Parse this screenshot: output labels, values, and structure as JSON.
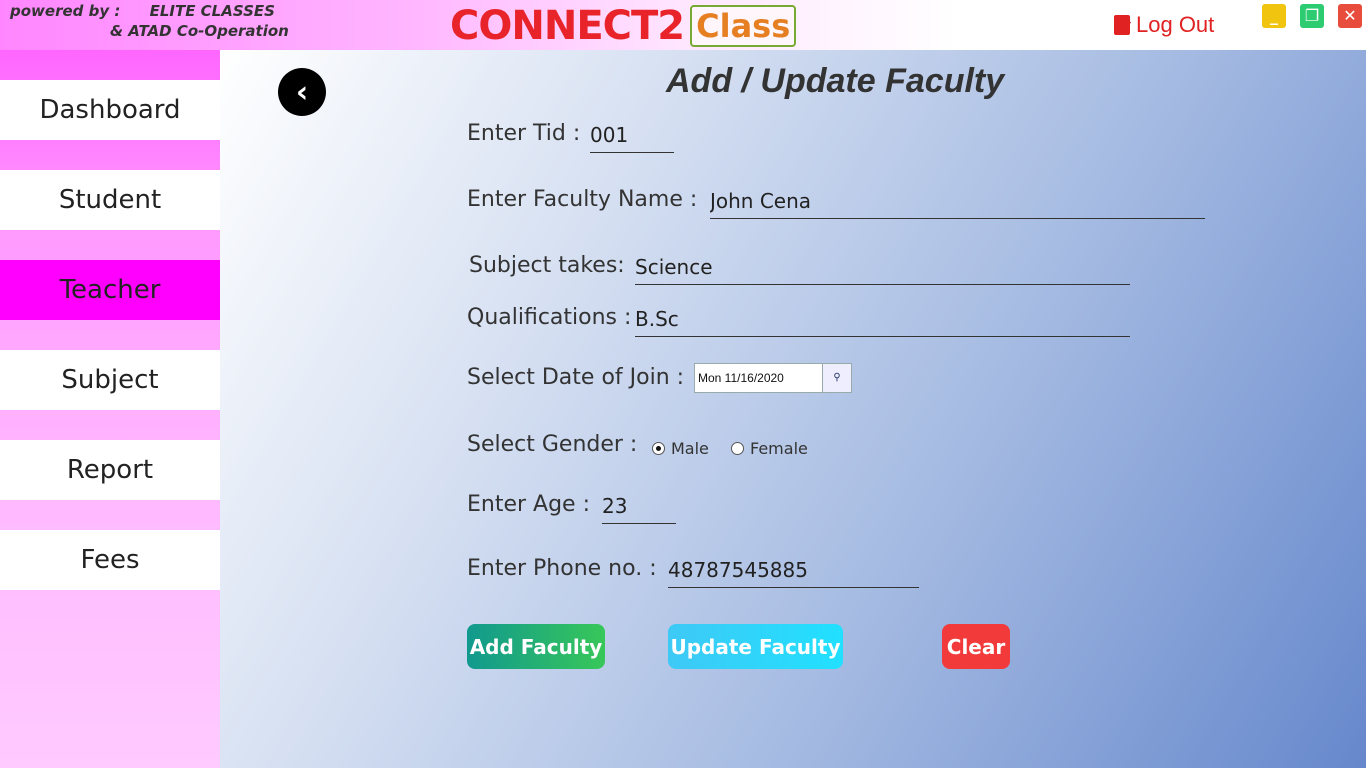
{
  "header": {
    "powered_line1": "powered by :",
    "powered_org": "ELITE CLASSES",
    "powered_line2": "& ATAD Co-Operation",
    "logo_main": "CONNECT2",
    "logo_class": "Class",
    "logout_label": "Log Out",
    "minimize": "_",
    "maximize": "❐",
    "close": "✕"
  },
  "sidebar": {
    "items": [
      {
        "label": "Dashboard",
        "active": false
      },
      {
        "label": "Student",
        "active": false
      },
      {
        "label": "Teacher",
        "active": true
      },
      {
        "label": "Subject",
        "active": false
      },
      {
        "label": "Report",
        "active": false
      },
      {
        "label": "Fees",
        "active": false
      }
    ]
  },
  "form": {
    "title": "Add / Update Faculty",
    "tid_label": "Enter Tid :",
    "tid_value": "001",
    "name_label": "Enter Faculty Name :",
    "name_value": "John Cena",
    "subject_label": "Subject takes:",
    "subject_value": "Science",
    "qual_label": "Qualifications :",
    "qual_value": "B.Sc",
    "doj_label": "Select Date of Join :",
    "doj_value": "Mon 11/16/2020",
    "gender_label": "Select Gender :",
    "gender_options": [
      "Male",
      "Female"
    ],
    "gender_selected": "Male",
    "age_label": "Enter Age :",
    "age_value": "23",
    "phone_label": "Enter Phone no. :",
    "phone_value": "48787545885",
    "add_button": "Add Faculty",
    "update_button": "Update Faculty",
    "clear_button": "Clear"
  },
  "icons": {
    "back": "chevron-left-icon",
    "logout": "logout-icon",
    "calendar": "calendar-icon"
  },
  "colors": {
    "active_nav": "#ff00ff",
    "logout": "#e02222",
    "add": "#11998e",
    "update": "#21e0ff",
    "clear": "#f23a3a"
  }
}
